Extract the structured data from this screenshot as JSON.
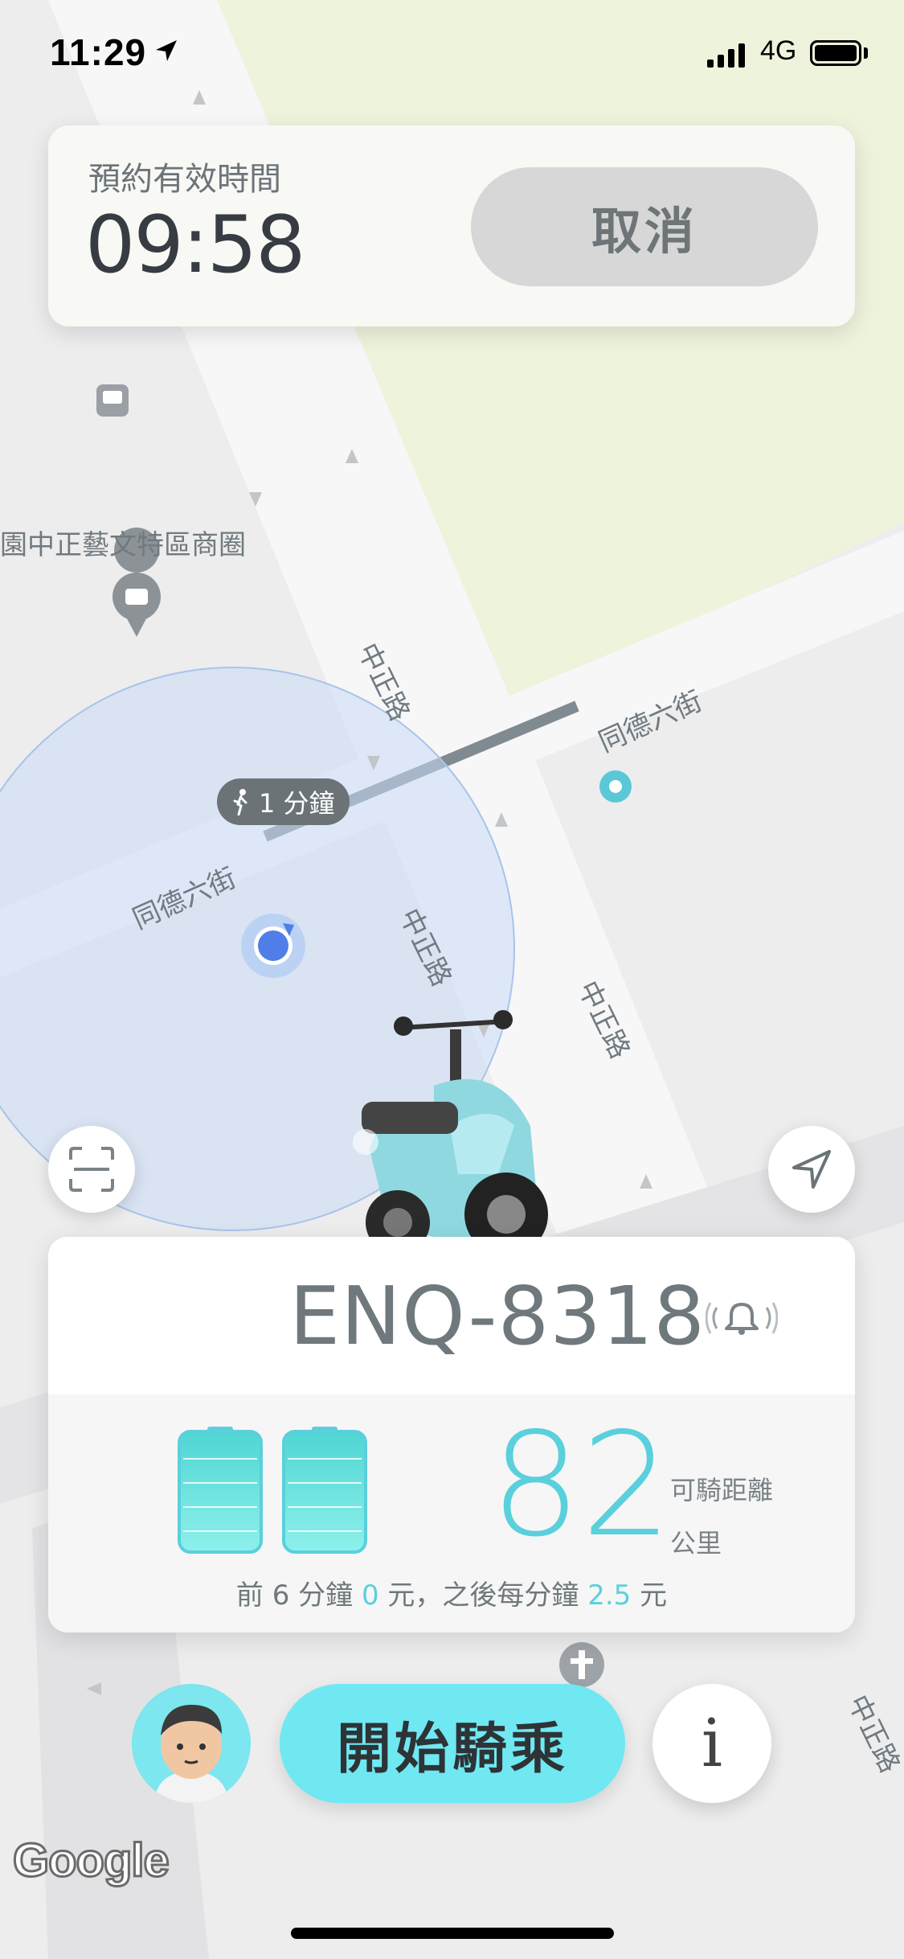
{
  "status_bar": {
    "time": "11:29",
    "network": "4G"
  },
  "map": {
    "labels": {
      "poi": "園中正藝文特區商圈",
      "road_zhongzheng": "中正路",
      "road_tongde_6": "同德六街"
    },
    "walk_badge": "1 分鐘",
    "attribution": "Google"
  },
  "reservation": {
    "label": "預約有效時間",
    "countdown": "09:58",
    "cancel_label": "取消"
  },
  "scooter": {
    "plate": "ENQ-8318",
    "batteries": 2,
    "range_value": "82",
    "range_label": "可騎距離",
    "range_unit": "公里",
    "price": {
      "prefix": "前 6 分鐘 ",
      "first_amount": "0",
      "middle": " 元，之後每分鐘 ",
      "per_minute": "2.5",
      "suffix": " 元"
    }
  },
  "actions": {
    "start_label": "開始騎乘",
    "info_label": "i"
  },
  "colors": {
    "accent": "#5ad0dc",
    "start_button": "#6fe8f2",
    "map_green": "#eef3dd",
    "location_blue": "#4f7ee8"
  }
}
